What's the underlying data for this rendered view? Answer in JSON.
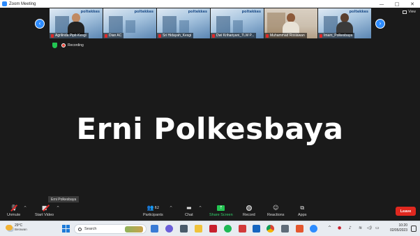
{
  "window": {
    "title": "Zoom Meeting",
    "controls": [
      "—",
      "□",
      "✕"
    ]
  },
  "gallery": {
    "participants": [
      {
        "name": "Agrilinda Pipit-Kesgi",
        "bg": "brand",
        "person": true
      },
      {
        "name": "Dian AC",
        "bg": "brand",
        "person": false
      },
      {
        "name": "Sri Hidayah_Kesgi",
        "bg": "brand",
        "person": false
      },
      {
        "name": "Dwi Krihariyani_TLM P...",
        "bg": "brand",
        "person": false
      },
      {
        "name": "Muhammad Rosiawan",
        "bg": "room",
        "person": true
      },
      {
        "name": "Imam_Polkesbaya",
        "bg": "brand",
        "person": true
      }
    ],
    "brand_text": "poltekkes",
    "view_label": "View"
  },
  "status": {
    "recording_label": "Recording",
    "shield_color": "#23c552",
    "record_color": "#e8463a"
  },
  "main": {
    "active_speaker": "Erni Polkesbaya"
  },
  "toolbar": {
    "hover_name": "Erni Polkesbaya",
    "unmute": "Unmute",
    "start_video": "Start Video",
    "participants": "Participants",
    "participant_count": "62",
    "chat": "Chat",
    "share_screen": "Share Screen",
    "record": "Record",
    "reactions": "Reactions",
    "apps": "Apps",
    "leave": "Leave",
    "leave_color": "#e0281f",
    "share_color": "#23c552"
  },
  "taskbar": {
    "temperature": "29°C",
    "weather": "Berawan",
    "search_placeholder": "Search",
    "time": "10:20",
    "date": "02/05/2023"
  }
}
